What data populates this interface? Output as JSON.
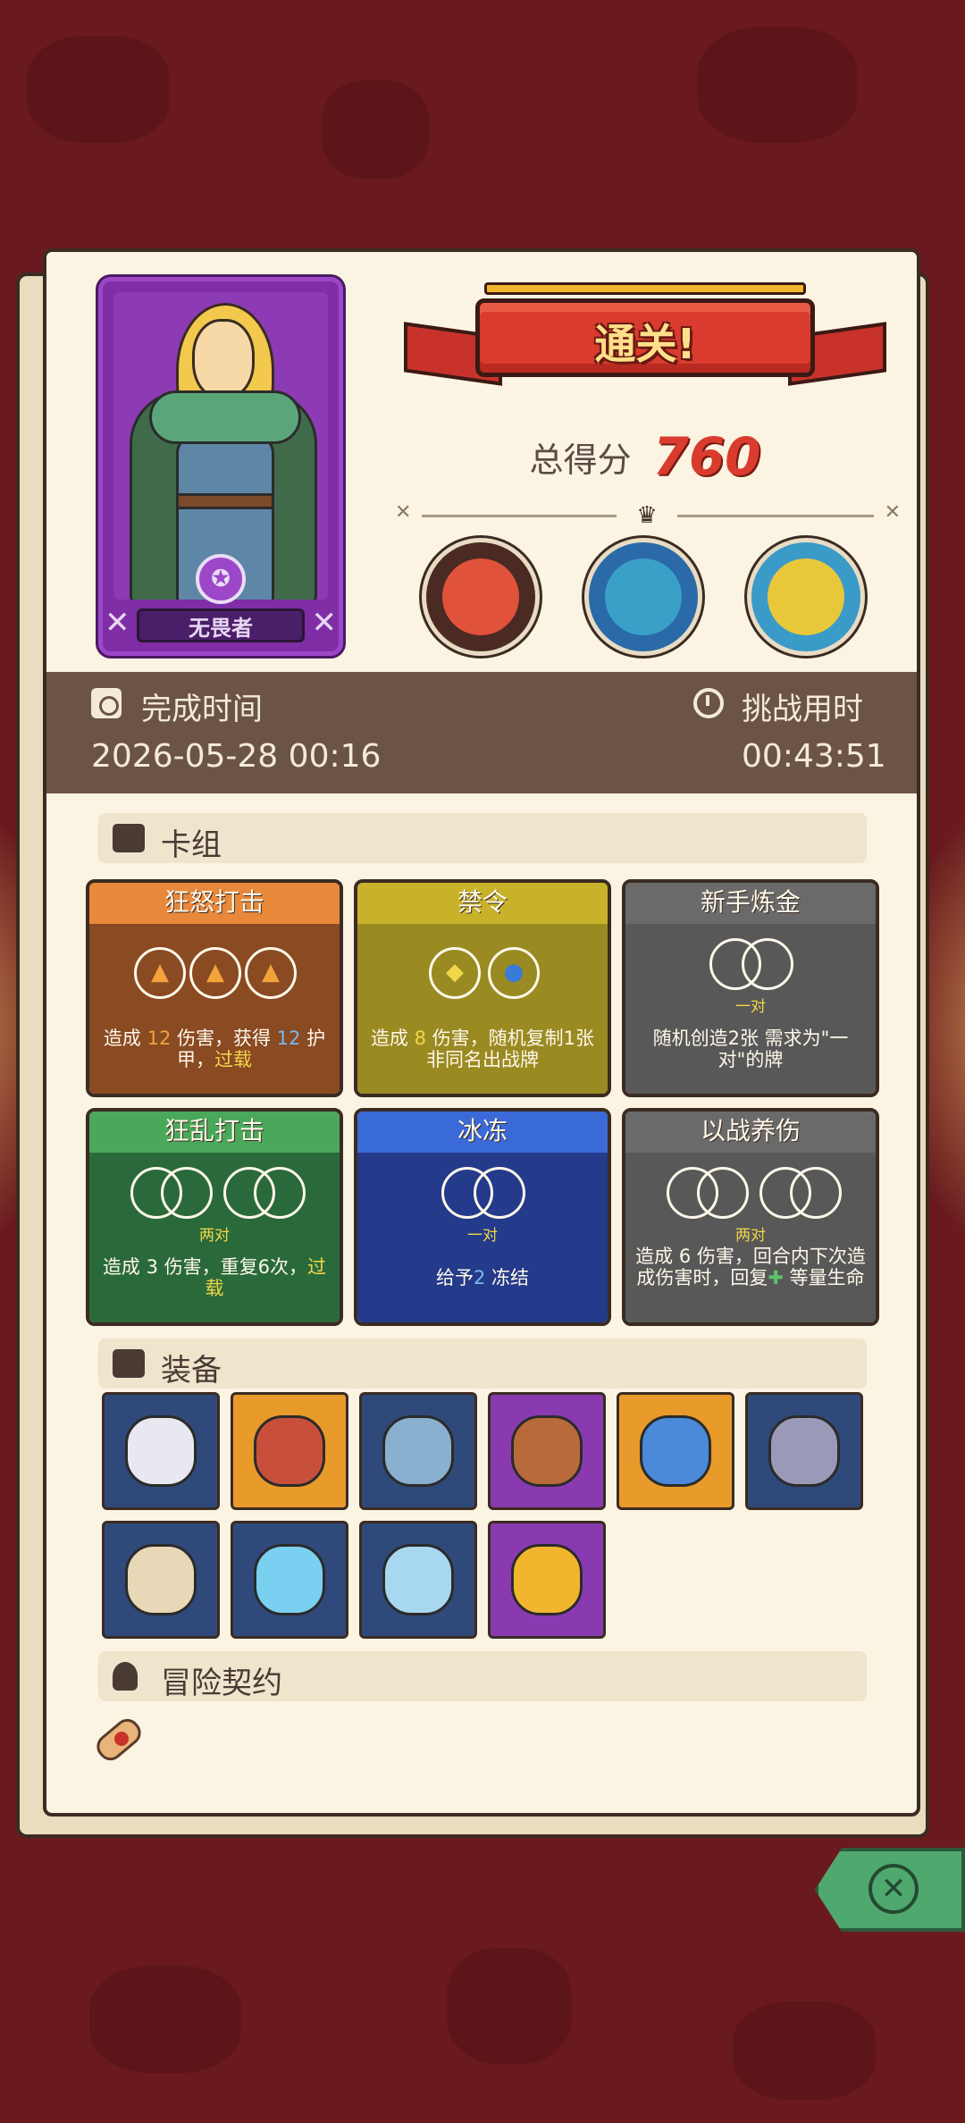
{
  "result": {
    "banner_text": "通关!",
    "score_label": "总得分",
    "score_value": "760"
  },
  "hero": {
    "name": "无畏者"
  },
  "bosses": [
    {
      "name": "boss-cyclops",
      "color": "#e0523a"
    },
    {
      "name": "boss-spider",
      "color": "#3aa0c8"
    },
    {
      "name": "boss-skull",
      "color": "#e8c83a"
    }
  ],
  "info": {
    "finish_time_label": "完成时间",
    "finish_time_value": "2026-05-28 00:16",
    "duration_label": "挑战用时",
    "duration_value": "00:43:51"
  },
  "sections": {
    "deck": "卡组",
    "equipment": "装备",
    "contract": "冒险契约"
  },
  "cards": [
    {
      "title": "狂怒打击",
      "sub": "",
      "desc_a": "造成 ",
      "desc_v1": "12",
      "desc_b": " 伤害，获得 ",
      "desc_v2": "12",
      "desc_c": " 护甲，",
      "desc_d": "过载",
      "color": "#e8883a",
      "body": "#8a4a22"
    },
    {
      "title": "禁令",
      "sub": "",
      "desc_a": "造成 ",
      "desc_v1": "8",
      "desc_b": " 伤害，随机复制1张非同名出战牌",
      "color": "#c8b22a",
      "body": "#9a8a22"
    },
    {
      "title": "新手炼金",
      "sub": "一对",
      "desc": "随机创造2张 需求为\"一对\"的牌",
      "color": "#6a6a6a",
      "body": "#585858"
    },
    {
      "title": "狂乱打击",
      "sub": "两对",
      "desc_a": "造成 ",
      "desc_v1": "3",
      "desc_b": " 伤害，重复6次，",
      "desc_d": "过载",
      "color": "#4aa85a",
      "body": "#2a6a3a"
    },
    {
      "title": "冰冻",
      "sub": "一对",
      "desc_a": "给予",
      "desc_v1": "2",
      "desc_b": " 冻结",
      "color": "#3a6ad8",
      "body": "#243a8a"
    },
    {
      "title": "以战养伤",
      "sub": "两对",
      "desc_a": "造成 ",
      "desc_v1": "6",
      "desc_b": " 伤害，回合内下次造成伤害时，回复",
      "desc_c": " 等量生命",
      "color": "#6a6a6a",
      "body": "#585858"
    }
  ],
  "equipment": [
    {
      "name": "helmet-item",
      "bg": "#2f4a7a",
      "fg": "#e8e8f0"
    },
    {
      "name": "meat-item",
      "bg": "#e89a2a",
      "fg": "#c8503a"
    },
    {
      "name": "armor-item",
      "bg": "#2f4a7a",
      "fg": "#8ab0d0"
    },
    {
      "name": "bracer-item",
      "bg": "#8a3ab0",
      "fg": "#b86a3a"
    },
    {
      "name": "orb-staff-item",
      "bg": "#e89a2a",
      "fg": "#4a8ad8"
    },
    {
      "name": "gauntlet-item",
      "bg": "#2f4a7a",
      "fg": "#9a9ab8"
    },
    {
      "name": "scroll-item",
      "bg": "#2f4a7a",
      "fg": "#e8d8b8"
    },
    {
      "name": "crown-item",
      "bg": "#2f4a7a",
      "fg": "#7ad0f0"
    },
    {
      "name": "crystal-item",
      "bg": "#2f4a7a",
      "fg": "#a8d8f0"
    },
    {
      "name": "gold-crown-item",
      "bg": "#8a3ab0",
      "fg": "#f2b62e"
    }
  ]
}
